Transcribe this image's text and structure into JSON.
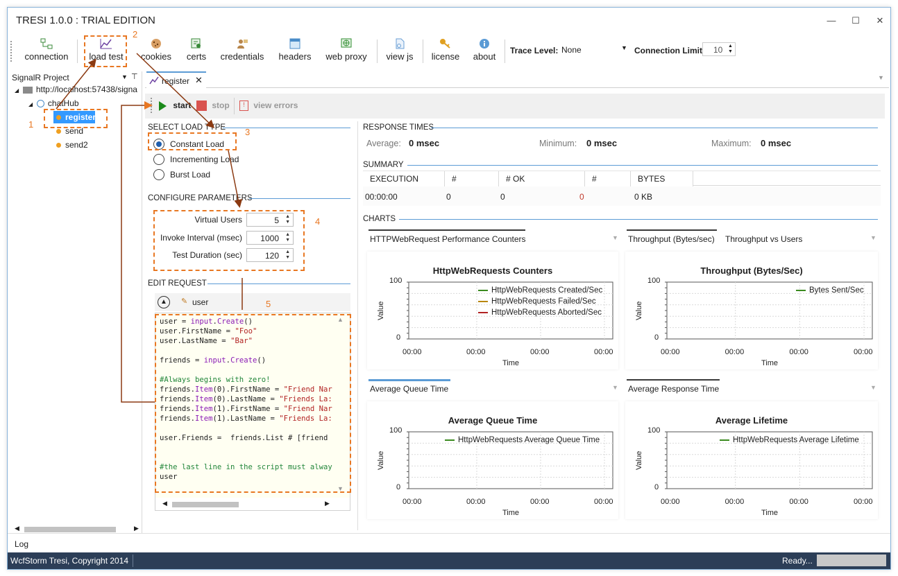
{
  "window": {
    "title": "TRESI 1.0.0 : TRIAL EDITION"
  },
  "toolbar": {
    "buttons": [
      {
        "label": "connection",
        "icon": "connection-icon"
      },
      {
        "label": "load test",
        "icon": "chart-icon"
      },
      {
        "label": "cookies",
        "icon": "cookie-icon"
      },
      {
        "label": "certs",
        "icon": "certificate-icon"
      },
      {
        "label": "credentials",
        "icon": "credentials-icon"
      },
      {
        "label": "headers",
        "icon": "headers-icon"
      },
      {
        "label": "web proxy",
        "icon": "globe-icon"
      },
      {
        "label": "view js",
        "icon": "js-file-icon"
      },
      {
        "label": "license",
        "icon": "key-icon"
      },
      {
        "label": "about",
        "icon": "info-icon"
      }
    ],
    "trace_level_label": "Trace Level:",
    "trace_level_value": "None",
    "connection_limit_label": "Connection Limit",
    "connection_limit_value": "10"
  },
  "project": {
    "header": "SignalR Project",
    "root": "http://localhost:57438/signa",
    "hub": "chatHub",
    "methods": [
      "register",
      "send",
      "send2"
    ]
  },
  "tab": {
    "label": "register"
  },
  "run_toolbar": {
    "start": "start",
    "stop": "stop",
    "view_errors": "view errors"
  },
  "load_type": {
    "title": "SELECT LOAD TYPE",
    "options": [
      "Constant Load",
      "Incrementing Load",
      "Burst Load"
    ],
    "selected": "Constant Load"
  },
  "params": {
    "title": "CONFIGURE PARAMETERS",
    "virtual_users_label": "Virtual Users",
    "virtual_users": "5",
    "invoke_interval_label": "Invoke Interval (msec)",
    "invoke_interval": "1000",
    "test_duration_label": "Test Duration (sec)",
    "test_duration": "120"
  },
  "edit_request": {
    "title": "EDIT REQUEST",
    "param_name": "user",
    "code_lines": [
      "user = input.Create()",
      "user.FirstName = \"Foo\"",
      "user.LastName = \"Bar\"",
      "",
      "friends = input.Create()",
      "",
      "#Always begins with zero!",
      "friends.Item(0).FirstName = \"Friend Nar",
      "friends.Item(0).LastName = \"Friends La:",
      "friends.Item(1).FirstName = \"Friend Nar",
      "friends.Item(1).LastName = \"Friends La:",
      "",
      "user.Friends =  friends.List # [friend",
      "",
      "",
      "#the last line in the script must alway",
      "user"
    ]
  },
  "response_times": {
    "title": "RESPONSE TIMES",
    "average_label": "Average:",
    "average": "0 msec",
    "minimum_label": "Minimum:",
    "minimum": "0 msec",
    "maximum_label": "Maximum:",
    "maximum": "0 msec"
  },
  "summary": {
    "title": "SUMMARY",
    "columns": [
      "EXECUTION TIME",
      "# AGENTS",
      "# OK RESPONSES",
      "# ERRORS",
      "BYTES SENT"
    ],
    "row": [
      "00:00:00",
      "0",
      "0",
      "0",
      "0 KB"
    ]
  },
  "charts_title": "CHARTS",
  "chart_tabs": {
    "top_left": [
      "HTTPWebRequest Performance Counters"
    ],
    "top_right": [
      "Throughput (Bytes/sec)",
      "Throughput vs Users"
    ],
    "bottom_left": [
      "Average Queue Time"
    ],
    "bottom_right": [
      "Average Response Time"
    ]
  },
  "chart_data": [
    {
      "type": "line",
      "title": "HttpWebRequests Counters",
      "xlabel": "Time",
      "ylabel": "Value",
      "ylim": [
        0,
        100
      ],
      "x_ticks": [
        "00:00",
        "00:00",
        "00:00",
        "00:00"
      ],
      "y_ticks": [
        "0",
        "100"
      ],
      "series": [
        {
          "name": "HttpWebRequests Created/Sec",
          "color": "#3a8a1e",
          "values": []
        },
        {
          "name": "HttpWebRequests Failed/Sec",
          "color": "#b8860b",
          "values": []
        },
        {
          "name": "HttpWebRequests Aborted/Sec",
          "color": "#b22222",
          "values": []
        }
      ]
    },
    {
      "type": "line",
      "title": "Throughput (Bytes/Sec)",
      "xlabel": "Time",
      "ylabel": "Value",
      "ylim": [
        0,
        100
      ],
      "x_ticks": [
        "00:00",
        "00:00",
        "00:00",
        "00:00"
      ],
      "y_ticks": [
        "0",
        "100"
      ],
      "series": [
        {
          "name": "Bytes Sent/Sec",
          "color": "#3a8a1e",
          "values": []
        }
      ]
    },
    {
      "type": "line",
      "title": "Average Queue Time",
      "xlabel": "Time",
      "ylabel": "Value",
      "ylim": [
        0,
        100
      ],
      "x_ticks": [
        "00:00",
        "00:00",
        "00:00",
        "00:00"
      ],
      "y_ticks": [
        "0",
        "100"
      ],
      "series": [
        {
          "name": "HttpWebRequests Average Queue Time",
          "color": "#3a8a1e",
          "values": []
        }
      ]
    },
    {
      "type": "line",
      "title": "Average Lifetime",
      "xlabel": "Time",
      "ylabel": "Value",
      "ylim": [
        0,
        100
      ],
      "x_ticks": [
        "00:00",
        "00:00",
        "00:00",
        "00:00"
      ],
      "y_ticks": [
        "0",
        "100"
      ],
      "series": [
        {
          "name": "HttpWebRequests Average Lifetime",
          "color": "#3a8a1e",
          "values": []
        }
      ]
    }
  ],
  "annotations": [
    "1",
    "2",
    "3",
    "4",
    "5"
  ],
  "log": {
    "label": "Log"
  },
  "status": {
    "copyright": "WcfStorm Tresi, Copyright 2014",
    "state": "Ready..."
  },
  "colors": {
    "accent": "#e87722",
    "selection": "#3399ff",
    "statusbar": "#2c3e57",
    "section_line": "#5b9bd5"
  }
}
